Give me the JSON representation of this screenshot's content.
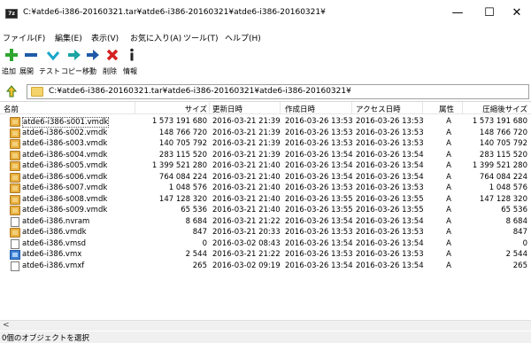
{
  "window": {
    "title": "C:¥atde6-i386-20160321.tar¥atde6-i386-20160321¥atde6-i386-20160321¥",
    "controls": {
      "minimize": "—",
      "maximize": "☐",
      "close": "✕"
    }
  },
  "menu": [
    "ファイル(F)",
    "編集(E)",
    "表示(V)",
    "お気に入り(A)",
    "ツール(T)",
    "ヘルプ(H)"
  ],
  "toolbar": [
    {
      "label": "追加",
      "icon": "add-icon",
      "color": "#2fa62f"
    },
    {
      "label": "展開",
      "icon": "extract-icon",
      "color": "#1f5aa8"
    },
    {
      "label": "テスト",
      "icon": "test-icon",
      "color": "#17a6c9"
    },
    {
      "label": "コピー",
      "icon": "copy-icon",
      "color": "#1ba3a3"
    },
    {
      "label": "移動",
      "icon": "move-icon",
      "color": "#1f5aa8"
    },
    {
      "label": "削除",
      "icon": "delete-icon",
      "color": "#d42020"
    },
    {
      "label": "情報",
      "icon": "info-icon",
      "color": "#222222"
    }
  ],
  "address": {
    "path": "C:¥atde6-i386-20160321.tar¥atde6-i386-20160321¥atde6-i386-20160321¥"
  },
  "columns": {
    "name": "名前",
    "size": "サイズ",
    "modified": "更新日時",
    "created": "作成日時",
    "accessed": "アクセス日時",
    "attr": "属性",
    "packed": "圧縮後サイズ"
  },
  "files": [
    {
      "name": "atde6-i386-s001.vmdk",
      "size": "1 573 191 680",
      "modified": "2016-03-21 21:39",
      "created": "2016-03-26 13:53",
      "accessed": "2016-03-26 13:53",
      "attr": "A",
      "packed": "1 573 191 680",
      "icon": "vmdk"
    },
    {
      "name": "atde6-i386-s002.vmdk",
      "size": "148 766 720",
      "modified": "2016-03-21 21:39",
      "created": "2016-03-26 13:53",
      "accessed": "2016-03-26 13:53",
      "attr": "A",
      "packed": "148 766 720",
      "icon": "vmdk"
    },
    {
      "name": "atde6-i386-s003.vmdk",
      "size": "140 705 792",
      "modified": "2016-03-21 21:39",
      "created": "2016-03-26 13:53",
      "accessed": "2016-03-26 13:53",
      "attr": "A",
      "packed": "140 705 792",
      "icon": "vmdk"
    },
    {
      "name": "atde6-i386-s004.vmdk",
      "size": "283 115 520",
      "modified": "2016-03-21 21:39",
      "created": "2016-03-26 13:54",
      "accessed": "2016-03-26 13:54",
      "attr": "A",
      "packed": "283 115 520",
      "icon": "vmdk"
    },
    {
      "name": "atde6-i386-s005.vmdk",
      "size": "1 399 521 280",
      "modified": "2016-03-21 21:40",
      "created": "2016-03-26 13:54",
      "accessed": "2016-03-26 13:54",
      "attr": "A",
      "packed": "1 399 521 280",
      "icon": "vmdk"
    },
    {
      "name": "atde6-i386-s006.vmdk",
      "size": "764 084 224",
      "modified": "2016-03-21 21:40",
      "created": "2016-03-26 13:54",
      "accessed": "2016-03-26 13:54",
      "attr": "A",
      "packed": "764 084 224",
      "icon": "vmdk"
    },
    {
      "name": "atde6-i386-s007.vmdk",
      "size": "1 048 576",
      "modified": "2016-03-21 21:40",
      "created": "2016-03-26 13:53",
      "accessed": "2016-03-26 13:53",
      "attr": "A",
      "packed": "1 048 576",
      "icon": "vmdk"
    },
    {
      "name": "atde6-i386-s008.vmdk",
      "size": "147 128 320",
      "modified": "2016-03-21 21:40",
      "created": "2016-03-26 13:55",
      "accessed": "2016-03-26 13:55",
      "attr": "A",
      "packed": "147 128 320",
      "icon": "vmdk"
    },
    {
      "name": "atde6-i386-s009.vmdk",
      "size": "65 536",
      "modified": "2016-03-21 21:40",
      "created": "2016-03-26 13:55",
      "accessed": "2016-03-26 13:55",
      "attr": "A",
      "packed": "65 536",
      "icon": "vmdk"
    },
    {
      "name": "atde6-i386.nvram",
      "size": "8 684",
      "modified": "2016-03-21 21:22",
      "created": "2016-03-26 13:54",
      "accessed": "2016-03-26 13:54",
      "attr": "A",
      "packed": "8 684",
      "icon": "blank"
    },
    {
      "name": "atde6-i386.vmdk",
      "size": "847",
      "modified": "2016-03-21 20:33",
      "created": "2016-03-26 13:53",
      "accessed": "2016-03-26 13:53",
      "attr": "A",
      "packed": "847",
      "icon": "vmdk"
    },
    {
      "name": "atde6-i386.vmsd",
      "size": "0",
      "modified": "2016-03-02 08:43",
      "created": "2016-03-26 13:54",
      "accessed": "2016-03-26 13:54",
      "attr": "A",
      "packed": "0",
      "icon": "blank"
    },
    {
      "name": "atde6-i386.vmx",
      "size": "2 544",
      "modified": "2016-03-21 21:22",
      "created": "2016-03-26 13:53",
      "accessed": "2016-03-26 13:53",
      "attr": "A",
      "packed": "2 544",
      "icon": "vmx"
    },
    {
      "name": "atde6-i386.vmxf",
      "size": "265",
      "modified": "2016-03-02 09:19",
      "created": "2016-03-26 13:54",
      "accessed": "2016-03-26 13:54",
      "attr": "A",
      "packed": "265",
      "icon": "blank"
    }
  ],
  "scrollbar": {
    "left_arrow": "<"
  },
  "status": {
    "text": "0個のオブジェクトを選択"
  }
}
